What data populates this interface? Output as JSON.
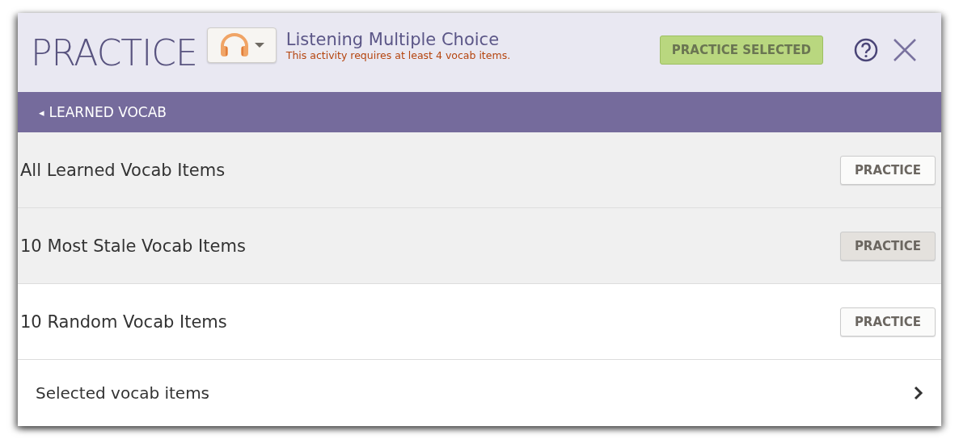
{
  "header": {
    "title": "PRACTICE",
    "activity_title": "Listening Multiple Choice",
    "warning": "This activity requires at least 4 vocab items.",
    "practice_selected_button": "PRACTICE SELECTED"
  },
  "section_bar": {
    "arrow": "◂",
    "label": "LEARNED VOCAB"
  },
  "rows": [
    {
      "label": "All Learned Vocab Items",
      "button": "PRACTICE",
      "shaded": true,
      "pressed": false
    },
    {
      "label": "10 Most Stale Vocab Items",
      "button": "PRACTICE",
      "shaded": true,
      "pressed": true
    },
    {
      "label": "10 Random Vocab Items",
      "button": "PRACTICE",
      "shaded": false,
      "pressed": false
    }
  ],
  "link_row": {
    "label": "Selected vocab items"
  }
}
